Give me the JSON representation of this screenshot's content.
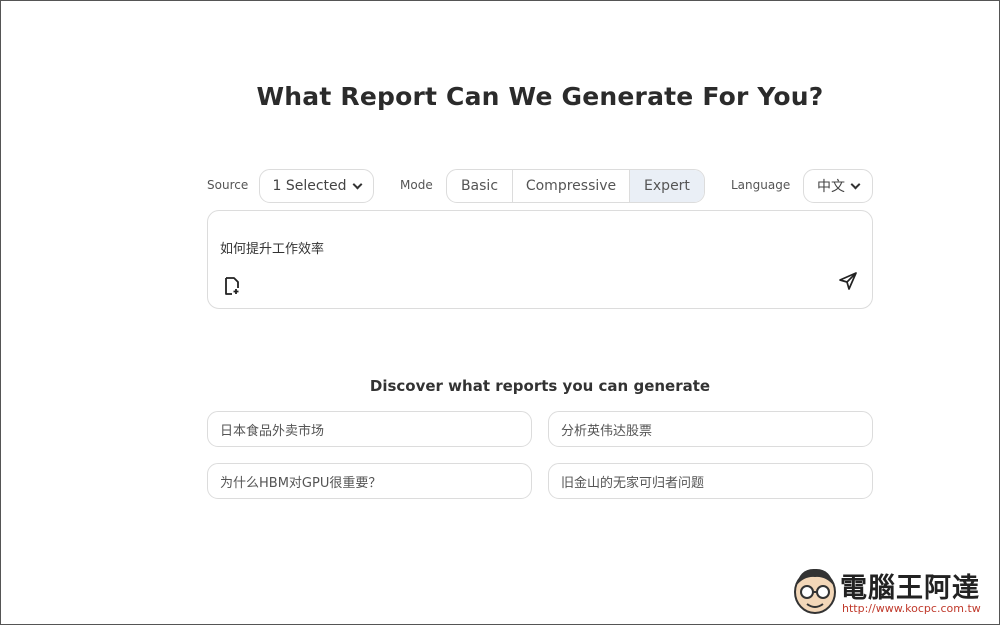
{
  "title": "What Report Can We Generate For You?",
  "controls": {
    "source_label": "Source",
    "source_value": "1 Selected",
    "mode_label": "Mode",
    "modes": [
      "Basic",
      "Compressive",
      "Expert"
    ],
    "selected_mode": "Expert",
    "language_label": "Language",
    "language_value": "中文"
  },
  "input": {
    "query": "如何提升工作效率"
  },
  "discover": {
    "heading": "Discover what reports you can generate",
    "suggestions": [
      "日本食品外卖市场",
      "分析英伟达股票",
      "为什么HBM对GPU很重要？",
      "旧金山的无家可归者问题"
    ]
  },
  "watermark": {
    "name": "電腦王阿達",
    "url": "http://www.kocpc.com.tw"
  },
  "colors": {
    "selected_mode_bg": "#eaeff6",
    "border": "#dcdcdc",
    "watermark_url": "#c0392b"
  }
}
